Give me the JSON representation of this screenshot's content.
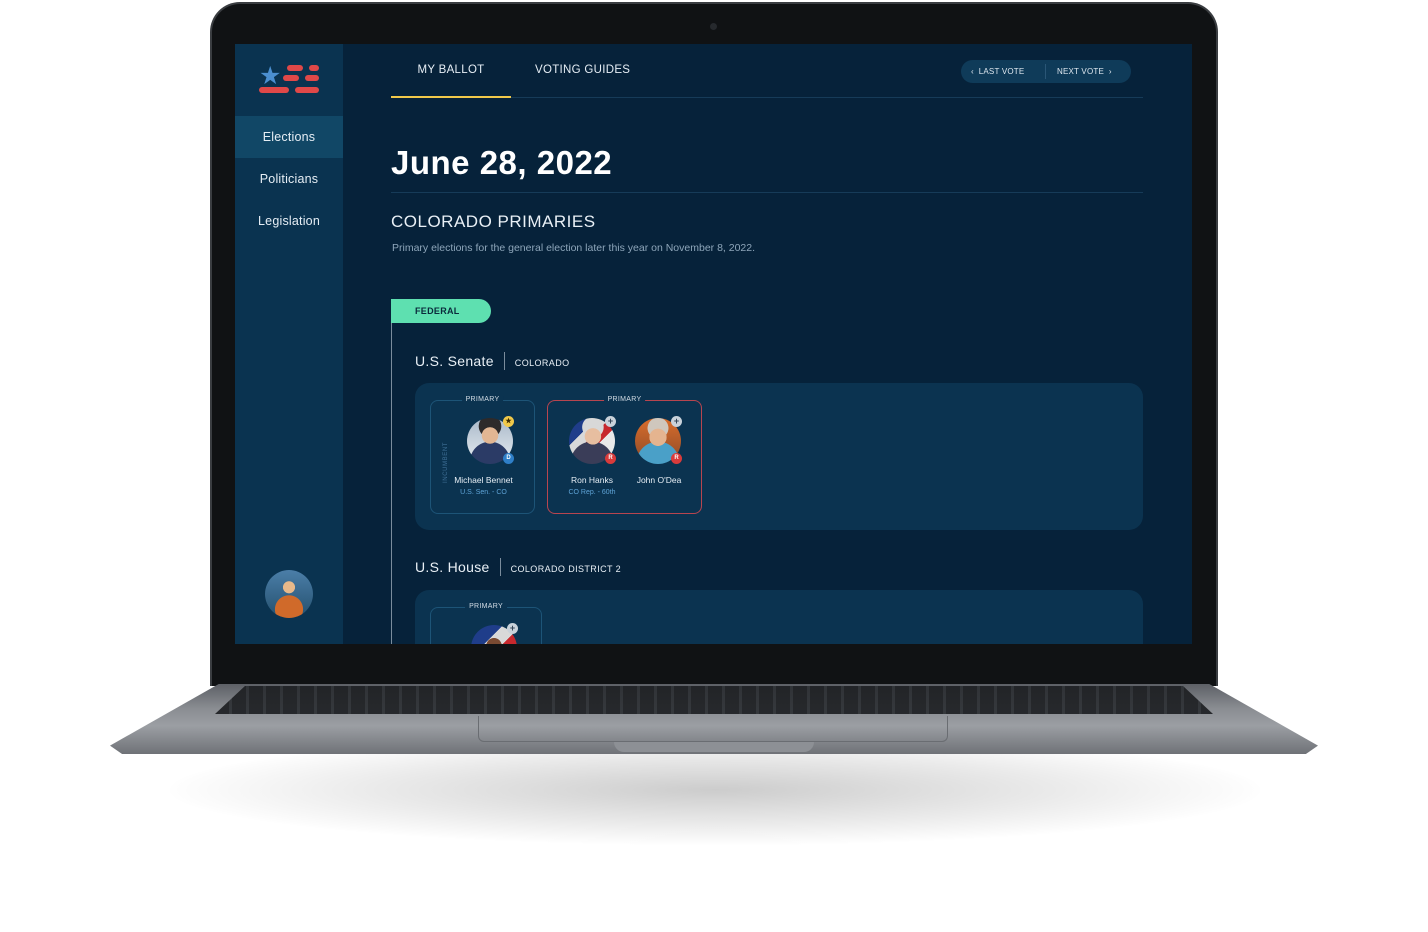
{
  "sidebar": {
    "items": [
      {
        "label": "Elections",
        "active": true
      },
      {
        "label": "Politicians",
        "active": false
      },
      {
        "label": "Legislation",
        "active": false
      }
    ],
    "logo_icon": "star-stripes-logo",
    "user_avatar_icon": "user-avatar"
  },
  "tabs": [
    {
      "label": "MY BALLOT",
      "active": true
    },
    {
      "label": "VOTING GUIDES",
      "active": false
    }
  ],
  "pager": {
    "prev_label": "LAST VOTE",
    "next_label": "NEXT VOTE",
    "prev_icon": "chevron-left-icon",
    "next_icon": "chevron-right-icon"
  },
  "election": {
    "date": "June 28, 2022",
    "title": "COLORADO PRIMARIES",
    "description": "Primary elections for the general election later this year on November 8, 2022."
  },
  "level_pill": "FEDERAL",
  "races": [
    {
      "title": "U.S. Senate",
      "region": "COLORADO",
      "groups": [
        {
          "label": "PRIMARY",
          "side_label": "INCUMBENT",
          "candidates": [
            {
              "name": "Michael Bennet",
              "office": "U.S. Sen. - CO",
              "party": "D",
              "badge": "★"
            }
          ]
        },
        {
          "label": "PRIMARY",
          "candidates": [
            {
              "name": "Ron Hanks",
              "office": "CO Rep. - 60th",
              "party": "R",
              "badge": "+"
            },
            {
              "name": "John O'Dea",
              "office": "",
              "party": "R",
              "badge": "+"
            }
          ]
        }
      ]
    },
    {
      "title": "U.S. House",
      "region": "COLORADO DISTRICT 2",
      "groups": [
        {
          "label": "PRIMARY",
          "candidates": [
            {
              "badge": "+"
            }
          ]
        }
      ]
    }
  ],
  "colors": {
    "background": "#06223a",
    "sidebar": "#0a3350",
    "accent_tab": "#f1c94a",
    "pill": "#5ee0b0",
    "democrat": "#2f7fc8",
    "republican": "#d93b3b"
  }
}
